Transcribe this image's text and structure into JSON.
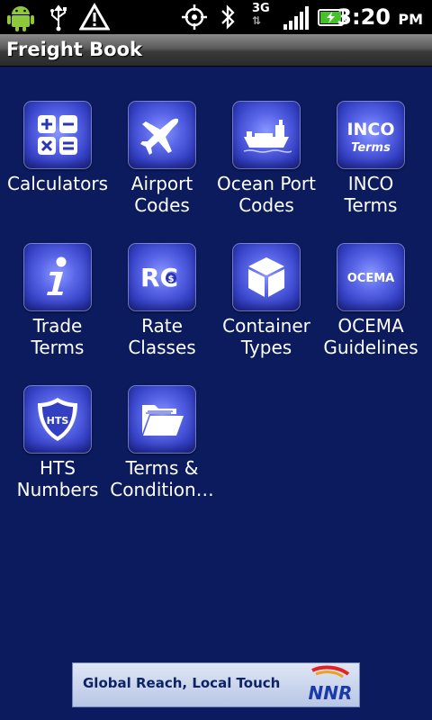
{
  "status_bar": {
    "time": "3:20",
    "ampm": "PM",
    "network": "3G",
    "icons": [
      "android-icon",
      "usb-icon",
      "warning-icon",
      "gps-icon",
      "bluetooth-icon",
      "3g-icon",
      "signal-icon",
      "battery-icon"
    ]
  },
  "app": {
    "title": "Freight Book"
  },
  "tiles": [
    {
      "label": "Calculators",
      "icon": "calculator-icon"
    },
    {
      "label": "Airport\nCodes",
      "icon": "airplane-icon"
    },
    {
      "label": "Ocean Port\nCodes",
      "icon": "ship-icon"
    },
    {
      "label": "INCO\nTerms",
      "icon": "inco-terms-icon",
      "icon_text": [
        "INCO",
        "Terms"
      ]
    },
    {
      "label": "Trade\nTerms",
      "icon": "info-icon"
    },
    {
      "label": "Rate Classes",
      "icon": "rate-class-icon",
      "icon_text": [
        "RC",
        "$"
      ]
    },
    {
      "label": "Container\nTypes",
      "icon": "box-icon"
    },
    {
      "label": "OCEMA\nGuidelines",
      "icon": "ocema-icon",
      "icon_text": [
        "OCEMA"
      ]
    },
    {
      "label": "HTS\nNumbers",
      "icon": "hts-shield-icon",
      "icon_text": [
        "HTS"
      ]
    },
    {
      "label": "Terms &\nCondition…",
      "icon": "folder-icon"
    }
  ],
  "ad": {
    "slogan": "Global Reach, Local Touch",
    "brand": "NNR"
  },
  "colors": {
    "background": "#0b1b5e",
    "icon_blue": "#4a56dd",
    "ad_text": "#0d2366"
  }
}
